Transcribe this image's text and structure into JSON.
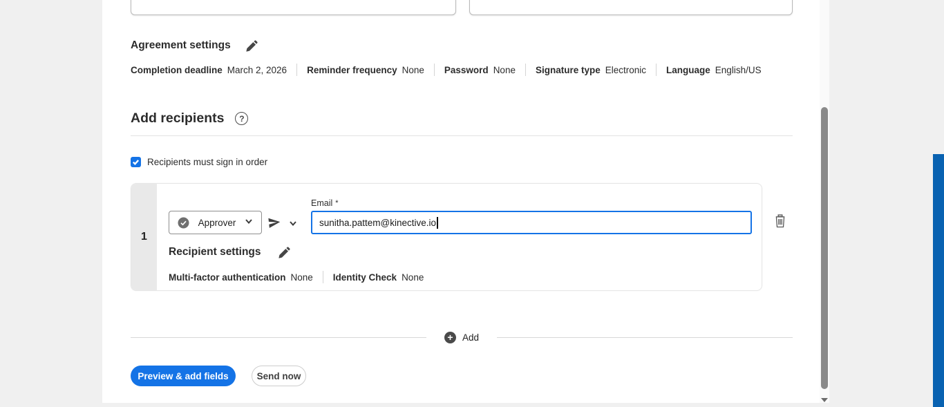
{
  "agreement_settings": {
    "title": "Agreement settings",
    "fields": [
      {
        "label": "Completion deadline",
        "value": "March 2, 2026"
      },
      {
        "label": "Reminder frequency",
        "value": "None"
      },
      {
        "label": "Password",
        "value": "None"
      },
      {
        "label": "Signature type",
        "value": "Electronic"
      },
      {
        "label": "Language",
        "value": "English/US"
      }
    ]
  },
  "add_recipients": {
    "title": "Add recipients",
    "sign_in_order_label": "Recipients must sign in order",
    "sign_in_order_checked": true
  },
  "recipient": {
    "index": "1",
    "role": "Approver",
    "email_label": "Email",
    "required_marker": "*",
    "email_value": "sunitha.pattem@kinective.io",
    "settings_title": "Recipient settings",
    "settings_fields": [
      {
        "label": "Multi-factor authentication",
        "value": "None"
      },
      {
        "label": "Identity Check",
        "value": "None"
      }
    ]
  },
  "add_row": {
    "label": "Add"
  },
  "actions": {
    "preview_label": "Preview & add fields",
    "send_label": "Send now"
  },
  "icons": {
    "edit": "pencil-icon",
    "help": "question-circle-icon",
    "role_status": "circle-check-icon",
    "send": "paper-plane-icon",
    "expand": "chevron-down-icon",
    "delete": "trash-icon",
    "add": "plus-circle-icon"
  },
  "colors": {
    "accent": "#1473e6",
    "checkbox": "#1473e6",
    "edge_bar": "#0962b1"
  }
}
